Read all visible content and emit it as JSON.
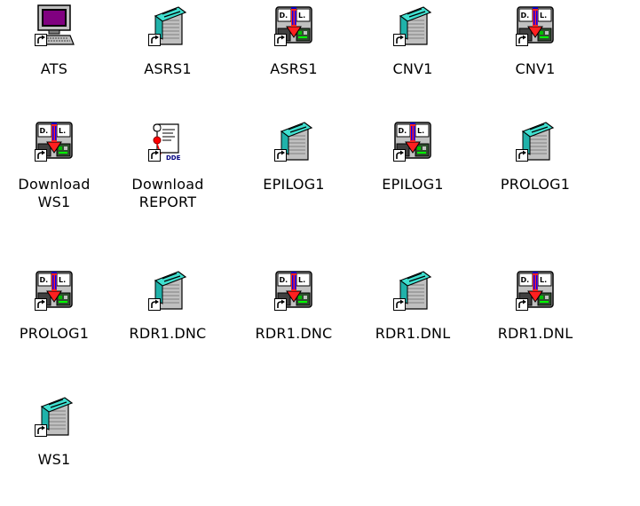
{
  "desktop": {
    "icons": [
      {
        "label": "ATS",
        "type": "computer"
      },
      {
        "label": "ASRS1",
        "type": "notepad"
      },
      {
        "label": "ASRS1",
        "type": "download"
      },
      {
        "label": "CNV1",
        "type": "notepad"
      },
      {
        "label": "CNV1",
        "type": "download"
      },
      {
        "label": "Download\nWS1",
        "type": "download"
      },
      {
        "label": "Download\nREPORT",
        "type": "report"
      },
      {
        "label": "EPILOG1",
        "type": "notepad"
      },
      {
        "label": "EPILOG1",
        "type": "download"
      },
      {
        "label": "PROLOG1",
        "type": "notepad"
      },
      {
        "label": "PROLOG1",
        "type": "download"
      },
      {
        "label": "RDR1.DNC",
        "type": "notepad"
      },
      {
        "label": "RDR1.DNC",
        "type": "download"
      },
      {
        "label": "RDR1.DNL",
        "type": "notepad"
      },
      {
        "label": "RDR1.DNL",
        "type": "download"
      },
      {
        "label": "WS1",
        "type": "notepad"
      }
    ]
  },
  "icon_tags": {
    "download_d": "D.",
    "download_l": "L.",
    "report_tag": "DDE"
  }
}
